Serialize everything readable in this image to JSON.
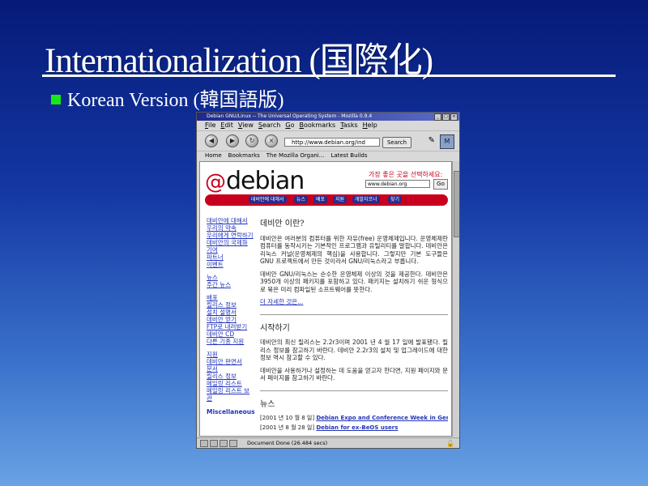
{
  "slide": {
    "title": "Internationalization (国際化)",
    "bullet": "Korean Version (韓国語版)"
  },
  "colors": {
    "bullet": "#19e619",
    "debian_red": "#c8001e",
    "link": "#2233bb"
  },
  "browser": {
    "title": "Debian GNU/Linux -- The Universal Operating System - Mozilla 0.9.4",
    "menus": [
      "File",
      "Edit",
      "View",
      "Search",
      "Go",
      "Bookmarks",
      "Tasks",
      "Help"
    ],
    "url": "http://www.debian.org/ind",
    "search_label": "Search",
    "bookmarks": [
      "Home",
      "Bookmarks",
      "The Mozilla Organi...",
      "Latest Builds"
    ],
    "status": "Document Done (26.484 secs)"
  },
  "page": {
    "logo": "debian",
    "lang_label": "가장 좋은 곳을 선택하세요:",
    "mirror": "www.debian.org",
    "go": "Go",
    "nav": [
      "데비안에 대해서",
      "뉴스",
      "배포",
      "지원",
      "개발자코너",
      "찾기"
    ],
    "sidebar": [
      "데비안에 대해서",
      "우리의 약속",
      "우리에게 연락하기",
      "데비안의 국제화",
      "기여",
      "파트너",
      "이벤트",
      "",
      "뉴스",
      "주간 뉴스",
      "",
      "배포",
      "릴리스 정보",
      "설치 설명서",
      "데비안 얻기",
      "FTP로 내려받기",
      "데비안 CD",
      "다른 기종 지원",
      "",
      "지원",
      "데비안 판면서",
      "문서",
      "릴리스 정보",
      "메일링 리스트",
      "메일링 리스트 보관"
    ],
    "misc": "Miscellaneous",
    "h1": "데비안 이란?",
    "p1": "데비안은 여러분의 컴퓨터를 위한 자유(free) 운영체제입니다. 운영체제란 컴퓨터를 동작시키는 기본적인 프로그램과 유틸리티를 말합니다. 데비안은 리눅스 커널(운영체제의 핵심)을 사용합니다. 그렇지만 기본 도구들은 GNU 프로젝트에서 만든 것이라서 GNU/리눅스라고 부릅니다.",
    "p2": "데비안 GNU/리눅스는 순수한 운영체제 이상의 것을 제공한다. 데비안은 3950개 이상의 패키지를 포함하고 있다. 패키지는 설치하기 쉬운 형식으로 묶은 미리 컴파일된 소프트웨어를 뜻한다.",
    "more": "더 자세한 것은...",
    "h2": "시작하기",
    "p3": "데비안의 최신 릴리스는 2.2r3이며 2001 년 4 월 17 일에 발표됐다. 릴리스 정보를 참고하기 바란다. 데비안 2.2r3의 설치 및 업그레이드에 대한 정보 역시 참고할 수 있다.",
    "p4": "데비안을 사용하거나 설정하는 데 도움을 얻고자 한다면, 지원 페이지와 문서 페이지를 참고하기 바란다.",
    "h3": "뉴스",
    "news": [
      {
        "date": "[2001 년 10 월 8 일]",
        "title": "Debian Expo and Conference Week in Germany"
      },
      {
        "date": "[2001 년 8 월 28 일]",
        "title": "Debian for ex-BeOS users"
      }
    ]
  }
}
